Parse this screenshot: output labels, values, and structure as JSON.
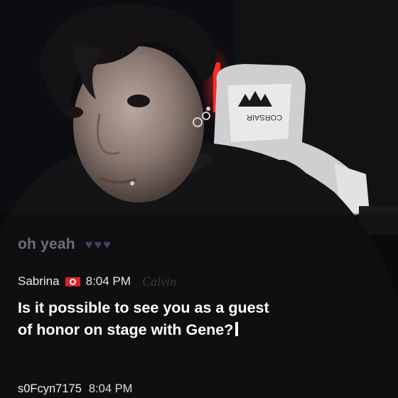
{
  "chat": {
    "messages": [
      {
        "text": "oh yeah",
        "hearts": "♥♥♥",
        "faded": true
      },
      {
        "username": "Sabrina",
        "flag_icon": "tunisia-flag-icon",
        "time": "8:04 PM",
        "text": "Is it possible to see you as a guest of honor on stage with Gene?"
      },
      {
        "username": "s0Fcyn7175",
        "time": "8:04 PM"
      }
    ]
  },
  "colors": {
    "text_primary": "#ffffff",
    "text_secondary": "#e6e6e6",
    "flag_red": "#e11f26"
  }
}
